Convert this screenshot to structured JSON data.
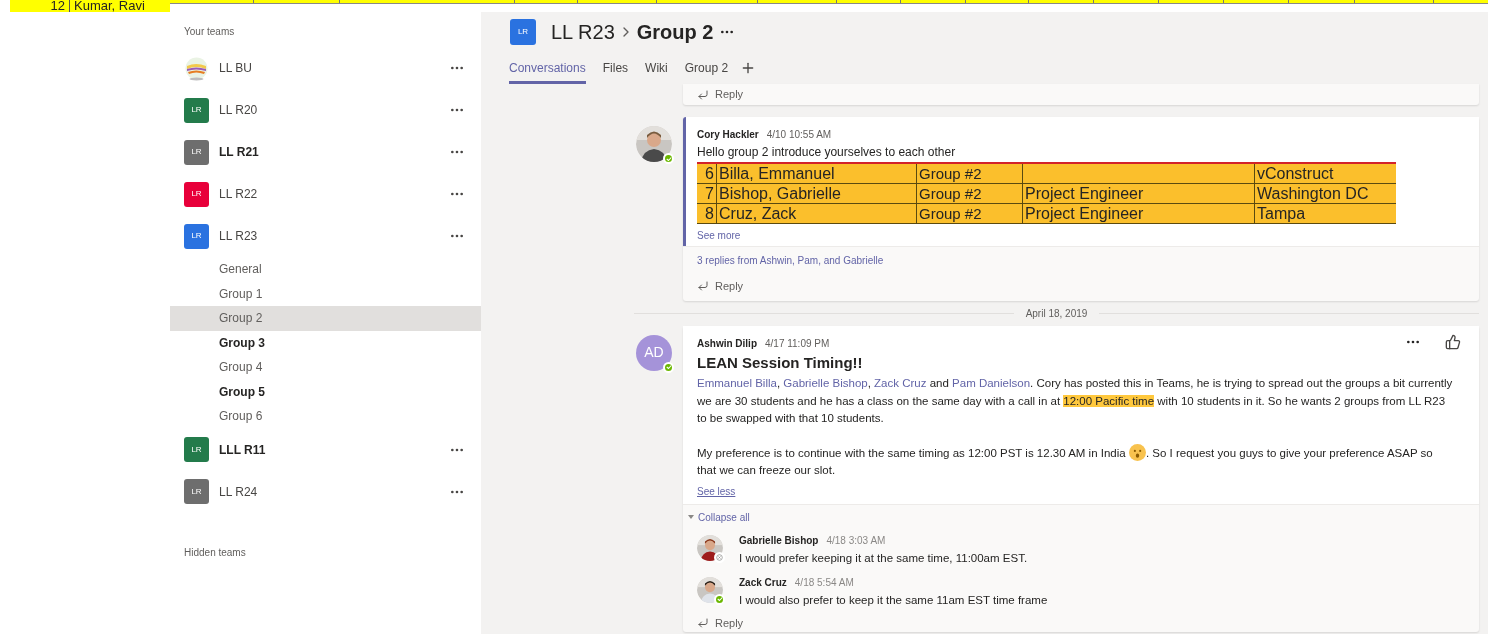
{
  "spreadsheet_strip": {
    "row_number": "12",
    "name": "Kumar, Ravi"
  },
  "sidebar": {
    "heading": "Your teams",
    "footer": "Hidden teams",
    "teams": [
      {
        "name": "LL BU",
        "kind": "picture",
        "unread": false
      },
      {
        "name": "LL R20",
        "kind": "initials",
        "initials": "LR",
        "color": "#237b4b",
        "unread": false
      },
      {
        "name": "LL R21",
        "kind": "initials",
        "initials": "LR",
        "color": "#6e6e6e",
        "unread": true
      },
      {
        "name": "LL R22",
        "kind": "initials",
        "initials": "LR",
        "color": "#e8003a",
        "unread": false
      },
      {
        "name": "LL R23",
        "kind": "initials",
        "initials": "LR",
        "color": "#2a72e0",
        "unread": false,
        "channels": [
          {
            "name": "General",
            "selected": false,
            "unread": false
          },
          {
            "name": "Group 1",
            "selected": false,
            "unread": false
          },
          {
            "name": "Group 2",
            "selected": true,
            "unread": false
          },
          {
            "name": "Group 3",
            "selected": false,
            "unread": true
          },
          {
            "name": "Group 4",
            "selected": false,
            "unread": false
          },
          {
            "name": "Group 5",
            "selected": false,
            "unread": true
          },
          {
            "name": "Group 6",
            "selected": false,
            "unread": false
          }
        ]
      },
      {
        "name": "LLL R11",
        "kind": "initials",
        "initials": "LR",
        "color": "#237b4b",
        "unread": true
      },
      {
        "name": "LL R24",
        "kind": "initials",
        "initials": "LR",
        "color": "#6e6e6e",
        "unread": false
      }
    ]
  },
  "header": {
    "initials": "LR",
    "color": "#2a72e0",
    "team": "LL R23",
    "channel": "Group 2"
  },
  "tabs": [
    {
      "label": "Conversations",
      "selected": true
    },
    {
      "label": "Files",
      "selected": false
    },
    {
      "label": "Wiki",
      "selected": false
    },
    {
      "label": "Group 2",
      "selected": false
    }
  ],
  "feed": {
    "top_reply": "Reply",
    "post_1": {
      "author": "Cory Hackler",
      "time": "4/10 10:55 AM",
      "available": true,
      "text": "Hello group 2 introduce yourselves to each other",
      "sheet_rows": [
        {
          "number": "6",
          "name": "Billa, Emmanuel",
          "group": "Group #2",
          "location": "vConstruct"
        },
        {
          "number": "7",
          "name": "Bishop, Gabrielle",
          "group": "Group #2",
          "role": "Project Engineer",
          "location": "Washington DC"
        },
        {
          "number": "8",
          "name": "Cruz, Zack",
          "group": "Group #2",
          "role": "Project Engineer",
          "location": "Tampa"
        }
      ],
      "see_more": "See more",
      "replies_summary": "3 replies from Ashwin, Pam, and Gabrielle",
      "reply": "Reply"
    },
    "date_divider": "April 18, 2019",
    "post_2": {
      "initials": "AD",
      "author": "Ashwin Dilip",
      "time": "4/17 11:09 PM",
      "available": true,
      "subject": "LEAN Session Timing!!",
      "paragraphs": [
        [
          {
            "kind": "mention",
            "text": "Emmanuel Billa"
          },
          {
            "kind": "plain",
            "text": ", "
          },
          {
            "kind": "mention",
            "text": "Gabrielle Bishop"
          },
          {
            "kind": "plain",
            "text": ",  "
          },
          {
            "kind": "mention",
            "text": "Zack Cruz"
          },
          {
            "kind": "plain",
            "text": " and "
          },
          {
            "kind": "mention",
            "text": "Pam Danielson"
          },
          {
            "kind": "plain",
            "text": ". Cory has posted this in Teams, he is trying to spread out the groups a bit currently we are 30 students and he has a class on the same day with a call in at "
          },
          {
            "kind": "highlight",
            "text": "12:00 Pacific time"
          },
          {
            "kind": "plain",
            "text": " with 10 students in it.  So he wants 2 groups from LL R23 to be swapped with that 10 students."
          }
        ],
        [
          {
            "kind": "plain",
            "text": "My preference is to continue with the same timing as 12:00 PST is 12.30 AM in India "
          },
          {
            "kind": "emoji"
          },
          {
            "kind": "plain",
            "text": ".  So I request you guys to give your preference ASAP so that we can freeze our slot."
          }
        ]
      ],
      "see_less": "See less",
      "collapse": "Collapse all",
      "replies": [
        {
          "author": "Gabrielle Bishop",
          "time": "4/18 3:03 AM",
          "available": false,
          "text": "I would prefer keeping it at the same time, 11:00am EST."
        },
        {
          "author": "Zack Cruz",
          "time": "4/18 5:54 AM",
          "available": true,
          "text": "I would also prefer to keep it the same 11am EST time frame"
        }
      ],
      "reply": "Reply"
    }
  }
}
